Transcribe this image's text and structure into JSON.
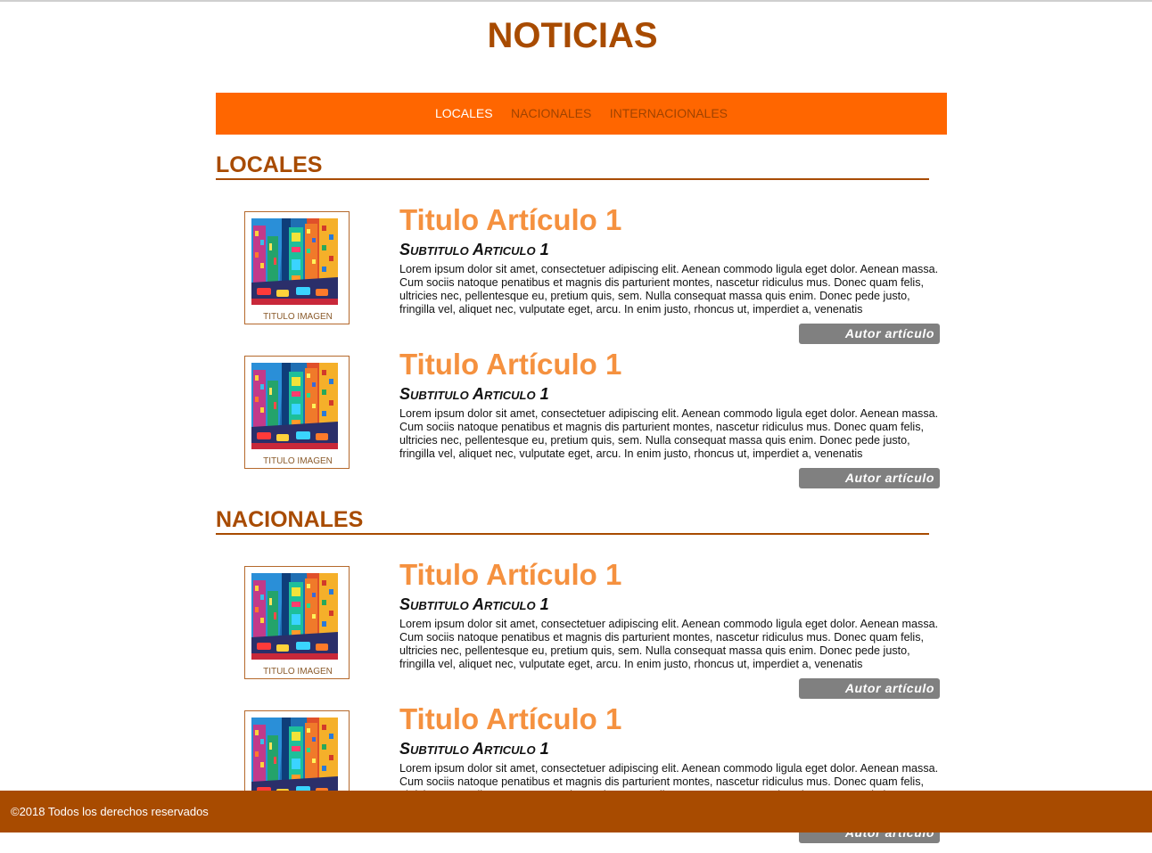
{
  "site": {
    "title": "NOTICIAS"
  },
  "nav": {
    "items": [
      "LOCALES",
      "NACIONALES",
      "INTERNACIONALES"
    ],
    "active_index": 0
  },
  "sections": [
    {
      "heading": "LOCALES"
    },
    {
      "heading": "NACIONALES"
    }
  ],
  "article": {
    "title": "Titulo Artículo 1",
    "subtitle": "Subtitulo Articulo 1",
    "body": "Lorem ipsum dolor sit amet, consectetuer adipiscing elit. Aenean commodo ligula eget dolor. Aenean massa. Cum sociis natoque penatibus et magnis dis parturient montes, nascetur ridiculus mus. Donec quam felis, ultricies nec, pellentesque eu, pretium quis, sem. Nulla consequat massa quis enim. Donec pede justo, fringilla vel, aliquet nec, vulputate eget, arcu. In enim justo, rhoncus ut, imperdiet a, venenatis",
    "image_caption": "TITULO IMAGEN",
    "author_label": "Autor artículo"
  },
  "footer": {
    "text": "©2018 Todos los derechos reservados"
  },
  "colors": {
    "brand": "#a84b00",
    "nav_bg": "#ff6600",
    "article_title": "#f5913f",
    "author_button": "#808080"
  }
}
